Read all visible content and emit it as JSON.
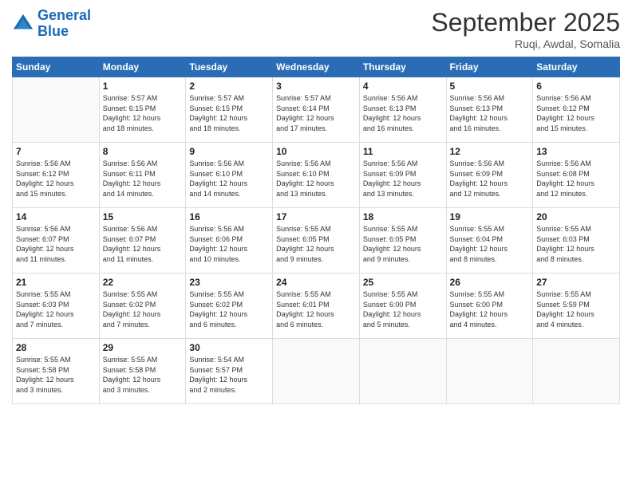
{
  "logo": {
    "line1": "General",
    "line2": "Blue"
  },
  "title": "September 2025",
  "subtitle": "Ruqi, Awdal, Somalia",
  "weekdays": [
    "Sunday",
    "Monday",
    "Tuesday",
    "Wednesday",
    "Thursday",
    "Friday",
    "Saturday"
  ],
  "weeks": [
    [
      {
        "day": null,
        "info": null
      },
      {
        "day": "1",
        "info": "Sunrise: 5:57 AM\nSunset: 6:15 PM\nDaylight: 12 hours\nand 18 minutes."
      },
      {
        "day": "2",
        "info": "Sunrise: 5:57 AM\nSunset: 6:15 PM\nDaylight: 12 hours\nand 18 minutes."
      },
      {
        "day": "3",
        "info": "Sunrise: 5:57 AM\nSunset: 6:14 PM\nDaylight: 12 hours\nand 17 minutes."
      },
      {
        "day": "4",
        "info": "Sunrise: 5:56 AM\nSunset: 6:13 PM\nDaylight: 12 hours\nand 16 minutes."
      },
      {
        "day": "5",
        "info": "Sunrise: 5:56 AM\nSunset: 6:13 PM\nDaylight: 12 hours\nand 16 minutes."
      },
      {
        "day": "6",
        "info": "Sunrise: 5:56 AM\nSunset: 6:12 PM\nDaylight: 12 hours\nand 15 minutes."
      }
    ],
    [
      {
        "day": "7",
        "info": "Sunrise: 5:56 AM\nSunset: 6:12 PM\nDaylight: 12 hours\nand 15 minutes."
      },
      {
        "day": "8",
        "info": "Sunrise: 5:56 AM\nSunset: 6:11 PM\nDaylight: 12 hours\nand 14 minutes."
      },
      {
        "day": "9",
        "info": "Sunrise: 5:56 AM\nSunset: 6:10 PM\nDaylight: 12 hours\nand 14 minutes."
      },
      {
        "day": "10",
        "info": "Sunrise: 5:56 AM\nSunset: 6:10 PM\nDaylight: 12 hours\nand 13 minutes."
      },
      {
        "day": "11",
        "info": "Sunrise: 5:56 AM\nSunset: 6:09 PM\nDaylight: 12 hours\nand 13 minutes."
      },
      {
        "day": "12",
        "info": "Sunrise: 5:56 AM\nSunset: 6:09 PM\nDaylight: 12 hours\nand 12 minutes."
      },
      {
        "day": "13",
        "info": "Sunrise: 5:56 AM\nSunset: 6:08 PM\nDaylight: 12 hours\nand 12 minutes."
      }
    ],
    [
      {
        "day": "14",
        "info": "Sunrise: 5:56 AM\nSunset: 6:07 PM\nDaylight: 12 hours\nand 11 minutes."
      },
      {
        "day": "15",
        "info": "Sunrise: 5:56 AM\nSunset: 6:07 PM\nDaylight: 12 hours\nand 11 minutes."
      },
      {
        "day": "16",
        "info": "Sunrise: 5:56 AM\nSunset: 6:06 PM\nDaylight: 12 hours\nand 10 minutes."
      },
      {
        "day": "17",
        "info": "Sunrise: 5:55 AM\nSunset: 6:05 PM\nDaylight: 12 hours\nand 9 minutes."
      },
      {
        "day": "18",
        "info": "Sunrise: 5:55 AM\nSunset: 6:05 PM\nDaylight: 12 hours\nand 9 minutes."
      },
      {
        "day": "19",
        "info": "Sunrise: 5:55 AM\nSunset: 6:04 PM\nDaylight: 12 hours\nand 8 minutes."
      },
      {
        "day": "20",
        "info": "Sunrise: 5:55 AM\nSunset: 6:03 PM\nDaylight: 12 hours\nand 8 minutes."
      }
    ],
    [
      {
        "day": "21",
        "info": "Sunrise: 5:55 AM\nSunset: 6:03 PM\nDaylight: 12 hours\nand 7 minutes."
      },
      {
        "day": "22",
        "info": "Sunrise: 5:55 AM\nSunset: 6:02 PM\nDaylight: 12 hours\nand 7 minutes."
      },
      {
        "day": "23",
        "info": "Sunrise: 5:55 AM\nSunset: 6:02 PM\nDaylight: 12 hours\nand 6 minutes."
      },
      {
        "day": "24",
        "info": "Sunrise: 5:55 AM\nSunset: 6:01 PM\nDaylight: 12 hours\nand 6 minutes."
      },
      {
        "day": "25",
        "info": "Sunrise: 5:55 AM\nSunset: 6:00 PM\nDaylight: 12 hours\nand 5 minutes."
      },
      {
        "day": "26",
        "info": "Sunrise: 5:55 AM\nSunset: 6:00 PM\nDaylight: 12 hours\nand 4 minutes."
      },
      {
        "day": "27",
        "info": "Sunrise: 5:55 AM\nSunset: 5:59 PM\nDaylight: 12 hours\nand 4 minutes."
      }
    ],
    [
      {
        "day": "28",
        "info": "Sunrise: 5:55 AM\nSunset: 5:58 PM\nDaylight: 12 hours\nand 3 minutes."
      },
      {
        "day": "29",
        "info": "Sunrise: 5:55 AM\nSunset: 5:58 PM\nDaylight: 12 hours\nand 3 minutes."
      },
      {
        "day": "30",
        "info": "Sunrise: 5:54 AM\nSunset: 5:57 PM\nDaylight: 12 hours\nand 2 minutes."
      },
      {
        "day": null,
        "info": null
      },
      {
        "day": null,
        "info": null
      },
      {
        "day": null,
        "info": null
      },
      {
        "day": null,
        "info": null
      }
    ]
  ]
}
